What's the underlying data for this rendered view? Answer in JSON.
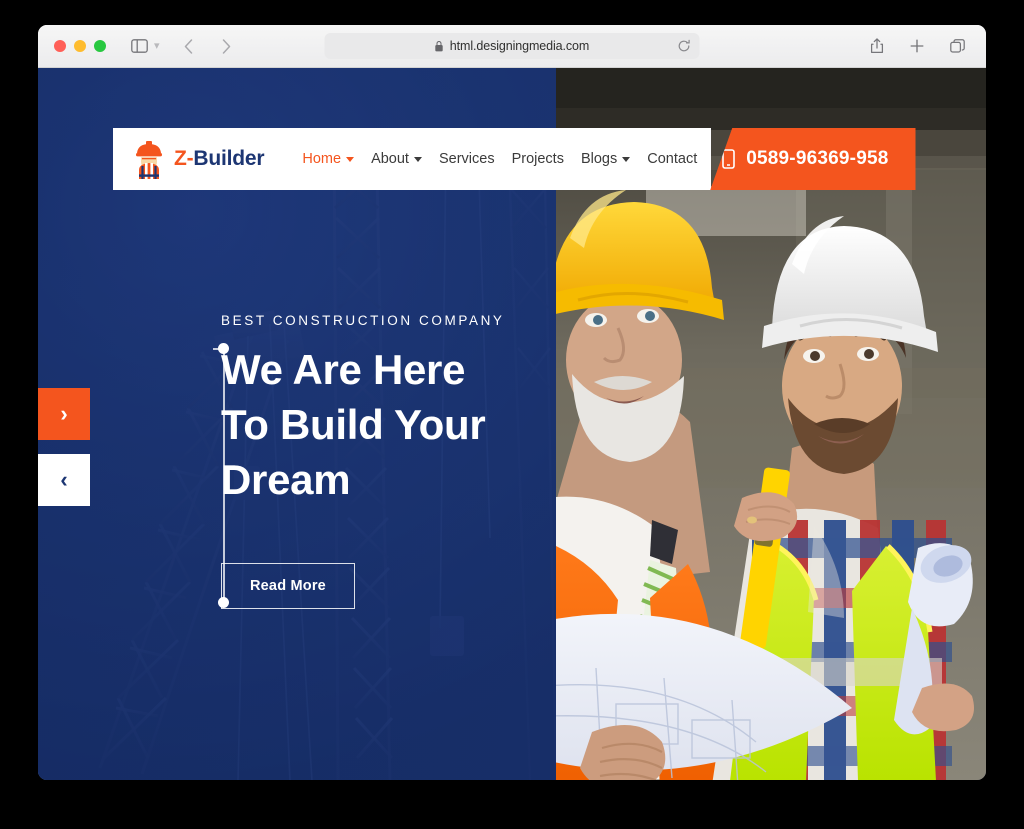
{
  "browser": {
    "url": "html.designingmedia.com",
    "icons": {
      "sidebar": "sidebar-toggle-icon",
      "sidebar_menu": "chevron-down-icon",
      "back": "back-arrow-icon",
      "forward": "forward-arrow-icon",
      "lock": "lock-icon",
      "reload": "reload-icon",
      "share": "share-icon",
      "new_tab": "plus-icon",
      "tabs": "tabs-overview-icon"
    },
    "traffic_lights": [
      "close",
      "minimize",
      "maximize"
    ]
  },
  "site": {
    "logo": {
      "icon": "construction-worker-icon",
      "text_accent": "Z-",
      "text_main": "Builder"
    },
    "nav": [
      {
        "label": "Home",
        "active": true,
        "has_dropdown": true
      },
      {
        "label": "About",
        "active": false,
        "has_dropdown": true
      },
      {
        "label": "Services",
        "active": false,
        "has_dropdown": false
      },
      {
        "label": "Projects",
        "active": false,
        "has_dropdown": false
      },
      {
        "label": "Blogs",
        "active": false,
        "has_dropdown": true
      },
      {
        "label": "Contact",
        "active": false,
        "has_dropdown": false
      }
    ],
    "phone": {
      "icon": "mobile-phone-icon",
      "number": "0589-96369-958"
    }
  },
  "hero": {
    "eyebrow": "BEST CONSTRUCTION COMPANY",
    "title_line1": "We Are Here",
    "title_line2": "To Build Your",
    "title_line3": "Dream",
    "cta_label": "Read More",
    "slider": {
      "next_icon": "chevron-right-icon",
      "next_glyph": "›",
      "prev_icon": "chevron-left-icon",
      "prev_glyph": "‹"
    },
    "background_left": "construction-crane-silhouette",
    "background_right": "two-construction-workers-photo"
  },
  "colors": {
    "navy": "#1d3673",
    "navy_dark": "#152a5f",
    "orange": "#f4551e",
    "white": "#ffffff",
    "nav_text": "#3b3b3b"
  }
}
